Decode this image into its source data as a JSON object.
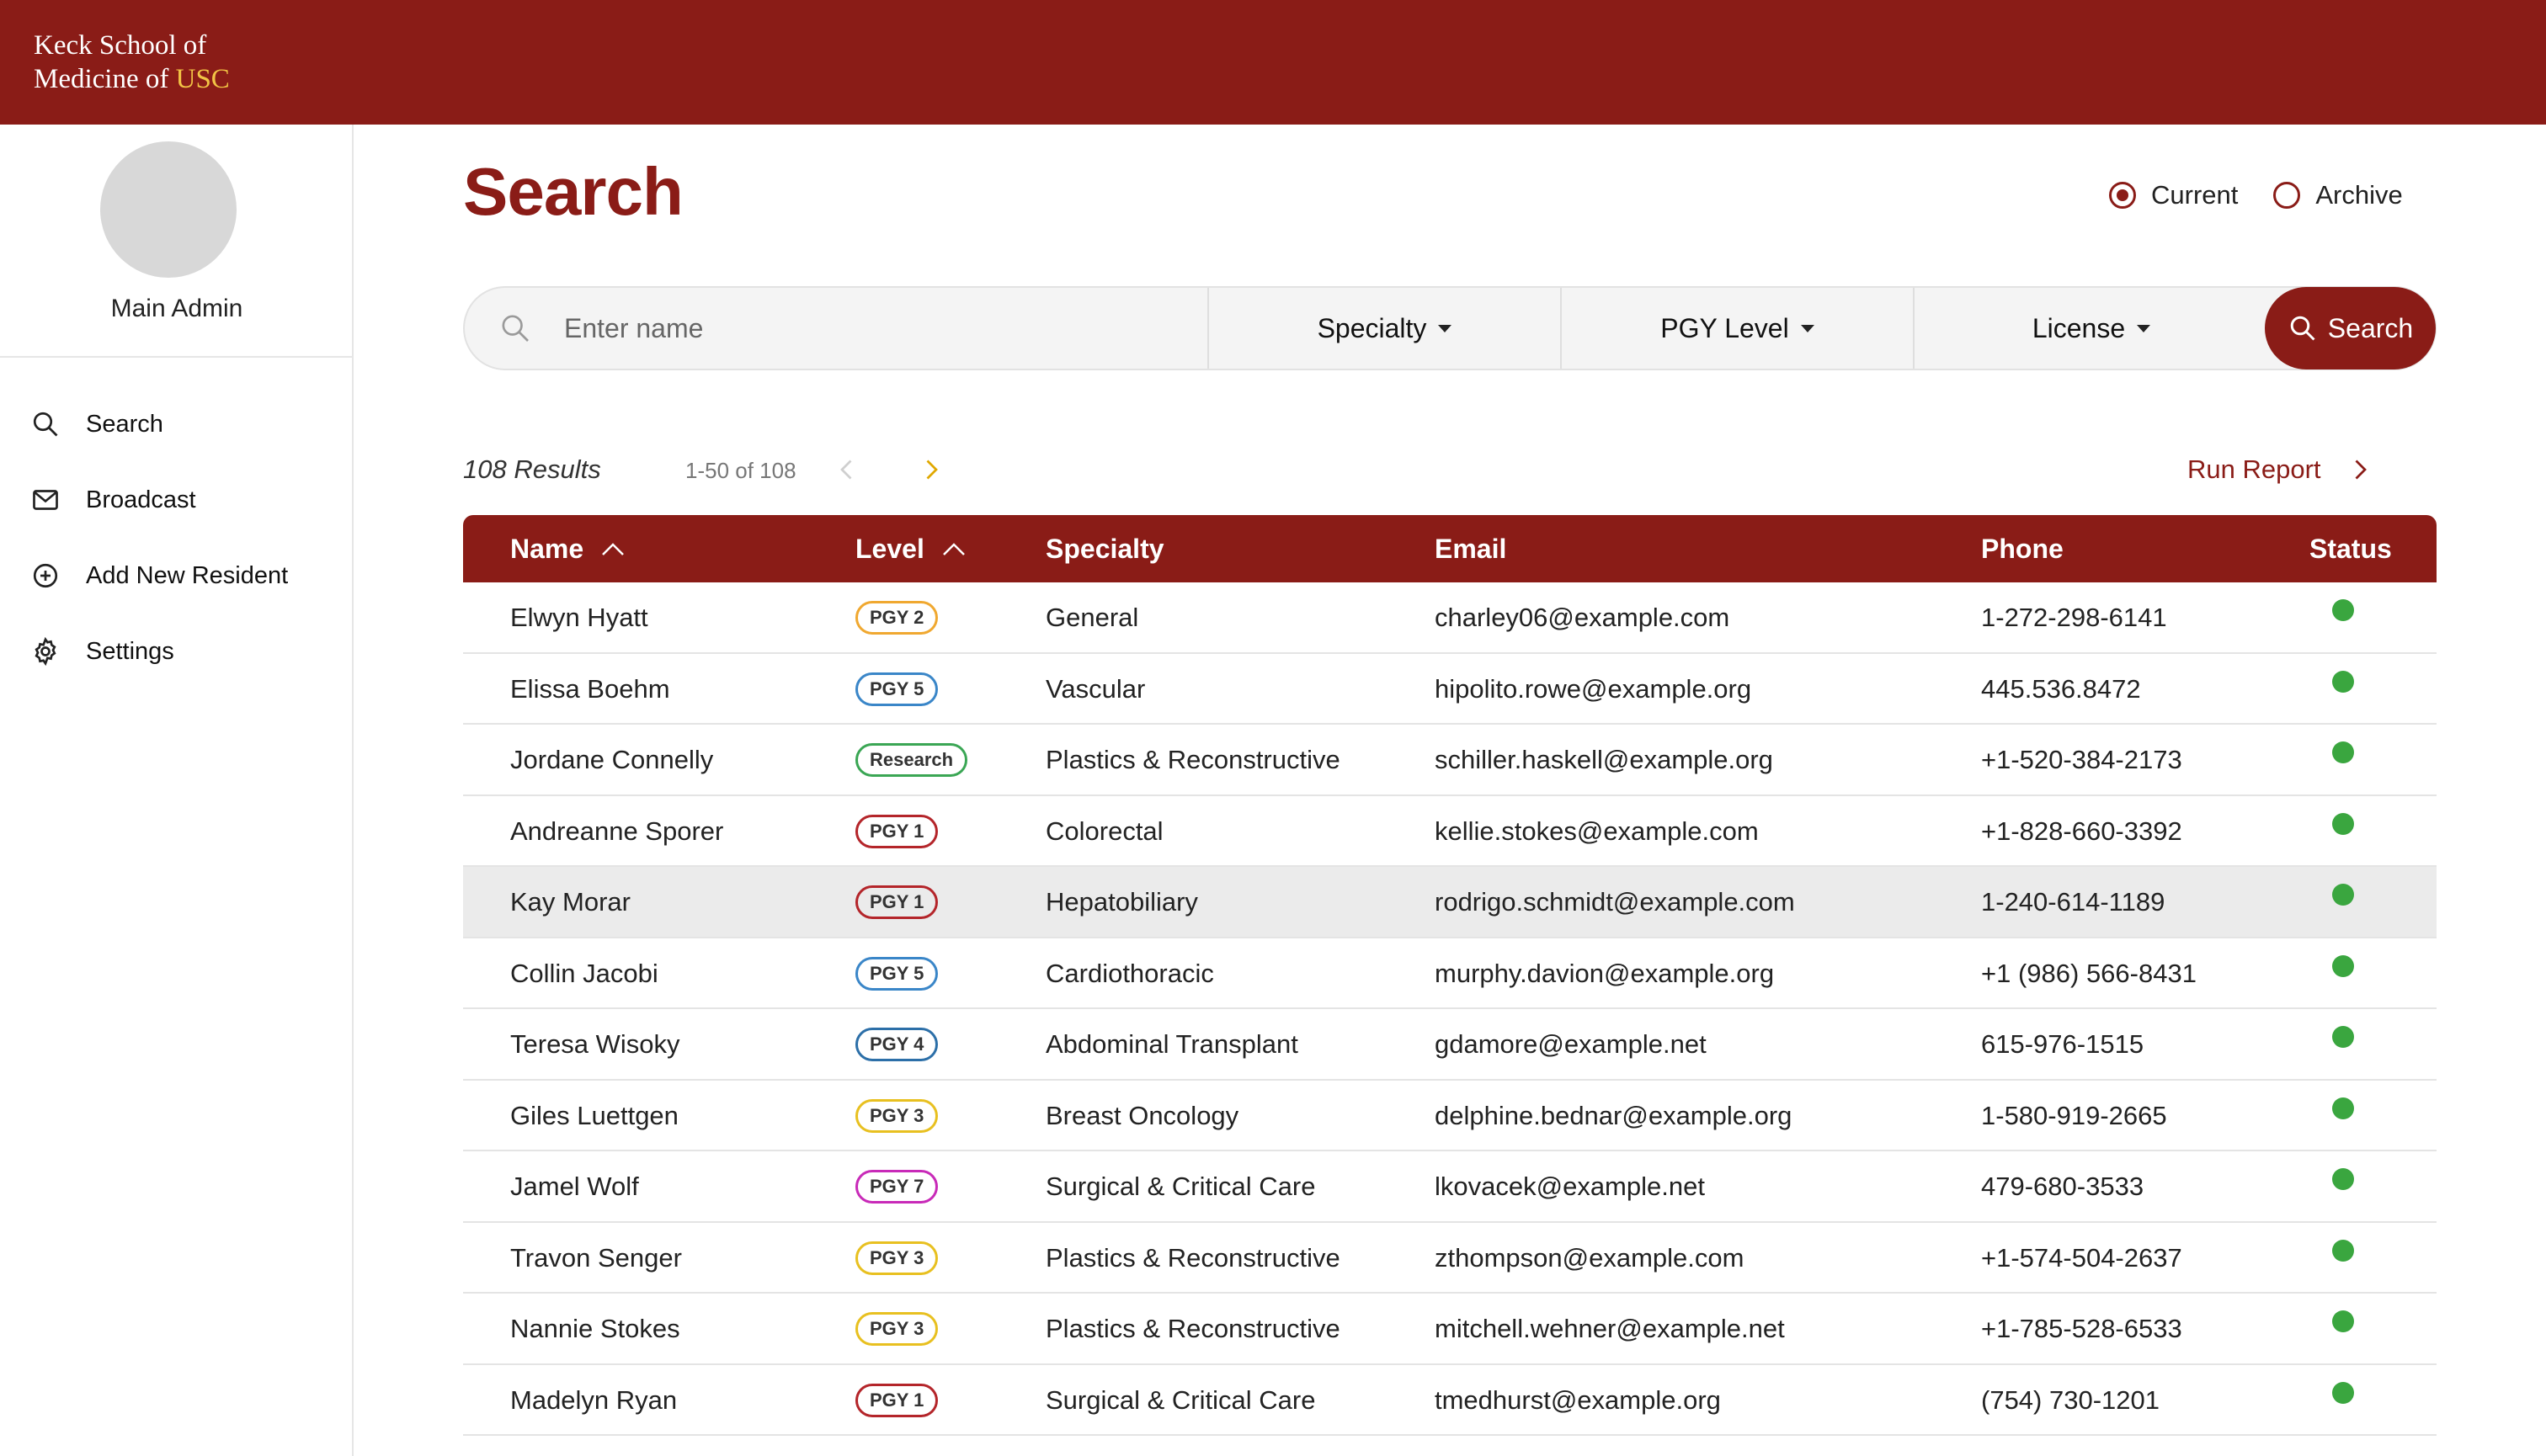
{
  "brand": {
    "line1": "Keck School of",
    "line2_prefix": "Medicine of ",
    "line2_accent": "USC",
    "accent_color": "#f2c445",
    "bar_color": "#8a1c17"
  },
  "sidebar": {
    "user_name": "Main Admin",
    "items": [
      {
        "label": "Search",
        "icon": "search-icon"
      },
      {
        "label": "Broadcast",
        "icon": "mail-icon"
      },
      {
        "label": "Add New Resident",
        "icon": "plus-circle-icon"
      },
      {
        "label": "Settings",
        "icon": "gear-icon"
      }
    ]
  },
  "page": {
    "title": "Search",
    "scope_options": [
      {
        "label": "Current",
        "selected": true
      },
      {
        "label": "Archive",
        "selected": false
      }
    ]
  },
  "search": {
    "placeholder": "Enter name",
    "value": "",
    "filters": [
      "Specialty",
      "PGY Level",
      "License"
    ],
    "button_label": "Search"
  },
  "results": {
    "count_label": "108 Results",
    "range_label": "1-50 of 108",
    "run_report_label": "Run Report"
  },
  "table": {
    "columns": [
      "Name",
      "Level",
      "Specialty",
      "Email",
      "Phone",
      "Status"
    ],
    "rows": [
      {
        "name": "Elwyn Hyatt",
        "level": "PGY 2",
        "level_color": "#f0a830",
        "specialty": "General",
        "email": "charley06@example.com",
        "phone": "1-272-298-6141",
        "status": "active"
      },
      {
        "name": "Elissa Boehm",
        "level": "PGY 5",
        "level_color": "#3a86c8",
        "specialty": "Vascular",
        "email": "hipolito.rowe@example.org",
        "phone": "445.536.8472",
        "status": "active"
      },
      {
        "name": "Jordane Connelly",
        "level": "Research",
        "level_color": "#3aa654",
        "specialty": "Plastics & Reconstructive",
        "email": "schiller.haskell@example.org",
        "phone": "+1-520-384-2173",
        "status": "active"
      },
      {
        "name": "Andreanne Sporer",
        "level": "PGY 1",
        "level_color": "#b4252a",
        "specialty": "Colorectal",
        "email": "kellie.stokes@example.com",
        "phone": "+1-828-660-3392",
        "status": "active"
      },
      {
        "name": "Kay Morar",
        "level": "PGY 1",
        "level_color": "#b4252a",
        "specialty": "Hepatobiliary",
        "email": "rodrigo.schmidt@example.com",
        "phone": "1-240-614-1189",
        "status": "active",
        "highlighted": true
      },
      {
        "name": "Collin Jacobi",
        "level": "PGY 5",
        "level_color": "#3a86c8",
        "specialty": "Cardiothoracic",
        "email": "murphy.davion@example.org",
        "phone": "+1 (986) 566-8431",
        "status": "active"
      },
      {
        "name": "Teresa Wisoky",
        "level": "PGY 4",
        "level_color": "#2c6fa8",
        "specialty": "Abdominal Transplant",
        "email": "gdamore@example.net",
        "phone": "615-976-1515",
        "status": "active"
      },
      {
        "name": "Giles Luettgen",
        "level": "PGY 3",
        "level_color": "#e8c020",
        "specialty": "Breast Oncology",
        "email": "delphine.bednar@example.org",
        "phone": "1-580-919-2665",
        "status": "active"
      },
      {
        "name": "Jamel Wolf",
        "level": "PGY 7",
        "level_color": "#c82ab8",
        "specialty": "Surgical & Critical Care",
        "email": "lkovacek@example.net",
        "phone": "479-680-3533",
        "status": "active"
      },
      {
        "name": "Travon Senger",
        "level": "PGY 3",
        "level_color": "#e8c020",
        "specialty": "Plastics & Reconstructive",
        "email": "zthompson@example.com",
        "phone": "+1-574-504-2637",
        "status": "active"
      },
      {
        "name": "Nannie Stokes",
        "level": "PGY 3",
        "level_color": "#e8c020",
        "specialty": "Plastics & Reconstructive",
        "email": "mitchell.wehner@example.net",
        "phone": "+1-785-528-6533",
        "status": "active"
      },
      {
        "name": "Madelyn Ryan",
        "level": "PGY 1",
        "level_color": "#b4252a",
        "specialty": "Surgical & Critical Care",
        "email": "tmedhurst@example.org",
        "phone": "(754) 730-1201",
        "status": "active"
      }
    ]
  }
}
